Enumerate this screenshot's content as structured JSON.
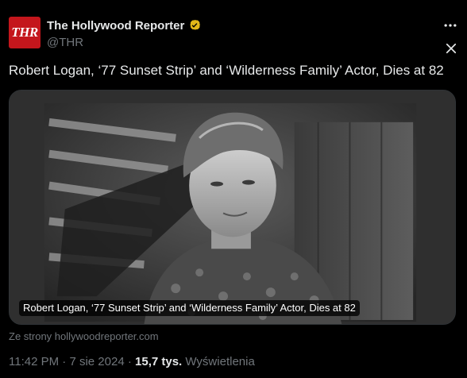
{
  "account": {
    "display_name": "The Hollywood Reporter",
    "handle": "@THR",
    "avatar_text": "THR",
    "verified_color": "#e2b719"
  },
  "tweet": {
    "text": "Robert Logan, ‘77 Sunset Strip’ and ‘Wilderness Family’ Actor, Dies at 82"
  },
  "card": {
    "title": "Robert Logan, ‘77 Sunset Strip’ and ‘Wilderness Family’ Actor, Dies at 82",
    "image_icon": "black-and-white-portrait-photo",
    "source": "Ze strony hollywoodreporter.com"
  },
  "meta": {
    "time": "11:42 PM",
    "sep1": "·",
    "date": "7 sie 2024",
    "sep2": "·",
    "views_count": "15,7 tys.",
    "views_label": "Wyświetlenia"
  },
  "icons": {
    "more": "more-options-icon",
    "close": "close-icon",
    "verified": "verified-badge-icon"
  }
}
